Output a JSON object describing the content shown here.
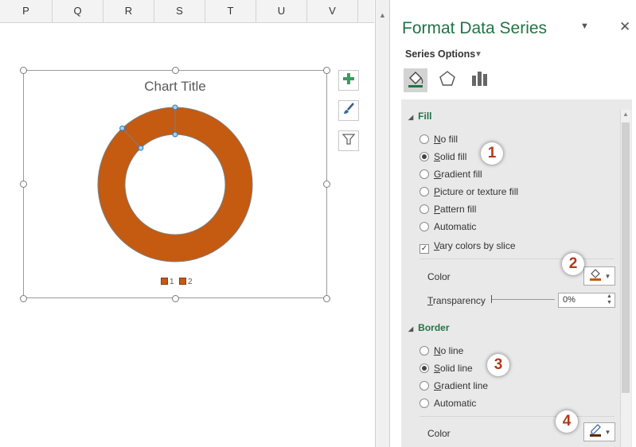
{
  "sheet": {
    "columns": [
      "P",
      "Q",
      "R",
      "S",
      "T",
      "U",
      "V"
    ]
  },
  "chart": {
    "title": "Chart Title",
    "legend": [
      "1",
      "2"
    ],
    "fill_color": "#c55a11",
    "side_buttons": [
      "chart-elements-icon",
      "chart-styles-icon",
      "chart-filters-icon"
    ]
  },
  "chart_data": {
    "type": "pie",
    "subtype": "doughnut",
    "title": "Chart Title",
    "categories": [
      "1",
      "2"
    ],
    "values": [
      88,
      12
    ],
    "legend_position": "bottom",
    "vary_colors_by_slice": true
  },
  "pane": {
    "title": "Format Data Series",
    "series_options_label": "Series Options",
    "tabs": [
      "fill-line-icon",
      "effects-icon",
      "series-options-icon"
    ],
    "fill": {
      "header": "Fill",
      "options": [
        {
          "label": "No fill",
          "accel": "N",
          "rest": "o fill",
          "checked": false
        },
        {
          "label": "Solid fill",
          "accel": "S",
          "rest": "olid fill",
          "checked": true
        },
        {
          "label": "Gradient fill",
          "accel": "G",
          "rest": "radient fill",
          "checked": false
        },
        {
          "label": "Picture or texture fill",
          "accel": "P",
          "rest": "icture or texture fill",
          "checked": false
        },
        {
          "label": "Pattern fill",
          "accel": "P",
          "rest": "attern fill",
          "checked": false
        },
        {
          "label": "Automatic",
          "accel": "",
          "rest": "Automatic",
          "checked": false
        }
      ],
      "vary_colors_label_accel": "V",
      "vary_colors_label_rest": "ary colors by slice",
      "vary_colors_checked": true,
      "color_label": "Color",
      "transparency_accel": "T",
      "transparency_rest": "ransparency",
      "transparency_value": "0%"
    },
    "border": {
      "header": "Border",
      "options": [
        {
          "label": "No line",
          "accel": "N",
          "rest": "o line",
          "checked": false
        },
        {
          "label": "Solid line",
          "accel": "S",
          "rest": "olid line",
          "checked": true
        },
        {
          "label": "Gradient line",
          "accel": "G",
          "rest": "radient line",
          "checked": false
        },
        {
          "label": "Automatic",
          "accel": "",
          "rest": "Automatic",
          "checked": false
        }
      ],
      "color_label": "Color"
    }
  },
  "callouts": [
    "1",
    "2",
    "3",
    "4"
  ]
}
